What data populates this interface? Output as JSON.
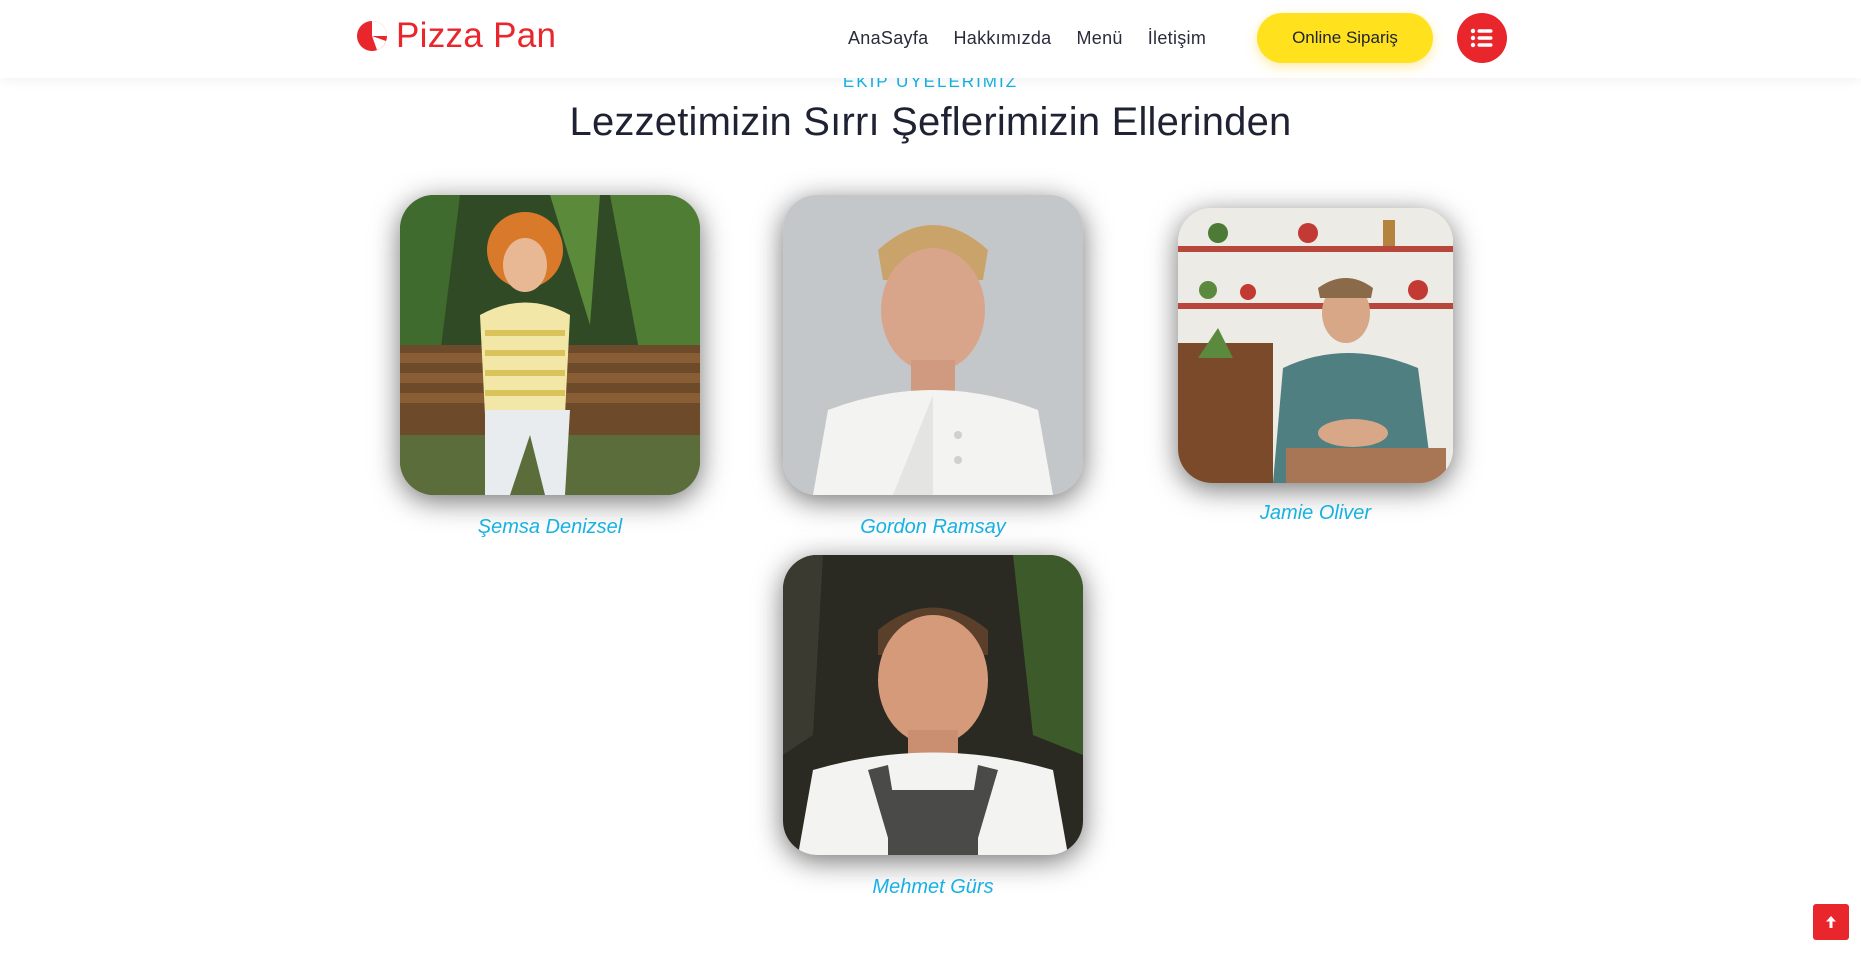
{
  "brand": {
    "name": "Pizza Pan",
    "logo_icon": "pizza-slice-icon",
    "color": "#e8262c"
  },
  "nav": {
    "items": [
      {
        "label": "AnaSayfa"
      },
      {
        "label": "Hakkımızda"
      },
      {
        "label": "Menü"
      },
      {
        "label": "İletişim"
      }
    ],
    "order_label": "Online Sipariş",
    "order_color": "#ffe11d",
    "menu_icon": "list-icon"
  },
  "section": {
    "eyebrow": "EKİP ÜYELERİMİZ",
    "title": "Lezzetimizin Sırrı Şeflerimizin Ellerinden",
    "accent": "#12b3e4"
  },
  "chefs": [
    {
      "name": "Şemsa Denizsel"
    },
    {
      "name": "Gordon Ramsay"
    },
    {
      "name": "Jamie Oliver"
    },
    {
      "name": "Mehmet Gürs"
    }
  ],
  "scroll_top": {
    "icon": "arrow-up-icon"
  }
}
